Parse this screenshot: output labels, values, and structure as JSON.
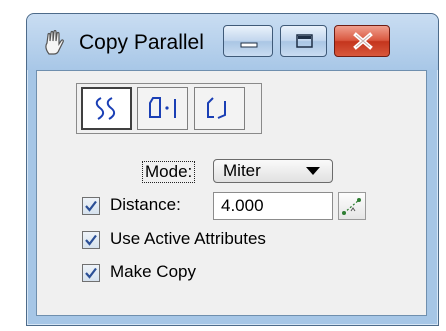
{
  "window": {
    "title": "Copy Parallel",
    "icon": "hand-icon",
    "controls": [
      "minimize-icon",
      "maximize-icon",
      "close-icon"
    ]
  },
  "tools": [
    {
      "name": "copy-parallel-tool",
      "icon": "wavy-lines-icon",
      "active": true
    },
    {
      "name": "copy-parallel-distance-tool",
      "icon": "shape-offset-icon",
      "active": false
    },
    {
      "name": "copy-parallel-keyin-tool",
      "icon": "corner-shape-icon",
      "active": false
    }
  ],
  "mode": {
    "label": "Mode:",
    "value": "Miter"
  },
  "distance": {
    "label": "Distance:",
    "value": "4.000",
    "checked": true
  },
  "use_active_attributes": {
    "label": "Use Active Attributes",
    "checked": true
  },
  "make_copy": {
    "label": "Make Copy",
    "checked": true
  },
  "colors": {
    "title_bar": "#a8c7e7",
    "close_button": "#c4351d",
    "panel": "#f0f0f0",
    "tool_stroke": "#1a3fb5"
  }
}
